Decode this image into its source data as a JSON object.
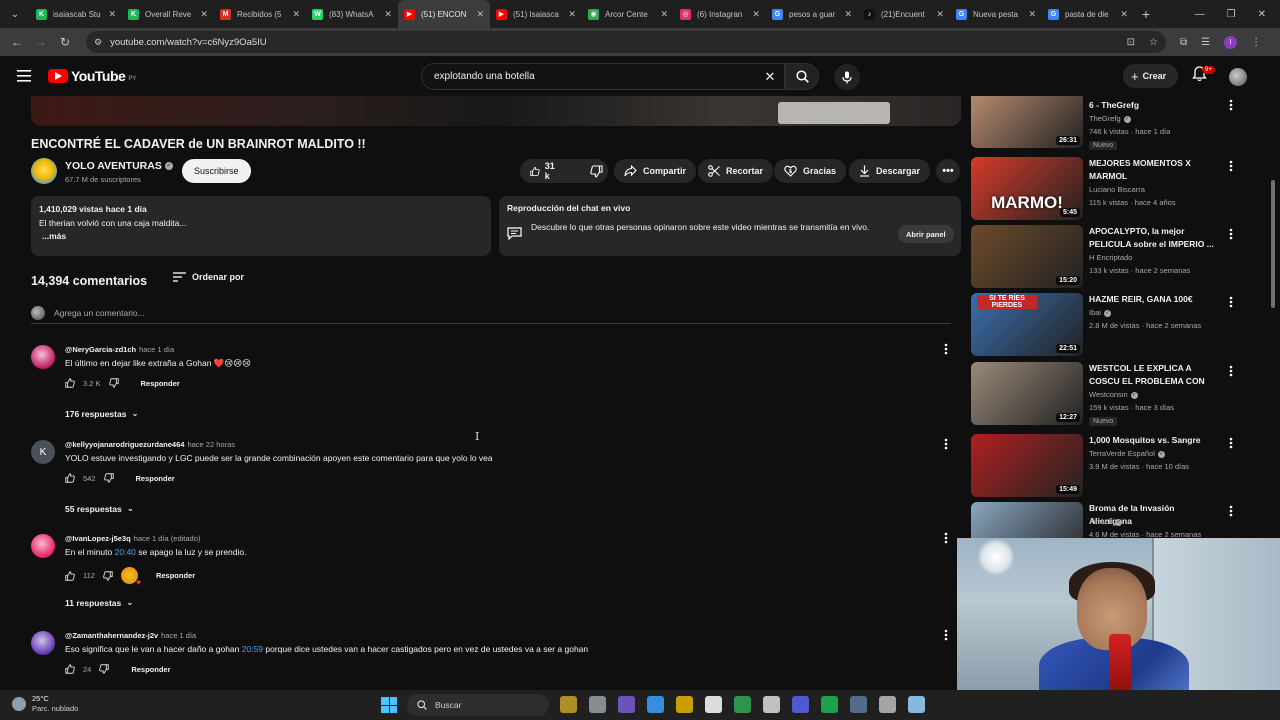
{
  "browser": {
    "tabs": [
      {
        "title": "isaiascab Stu",
        "color": "#1db954",
        "glyph": "K"
      },
      {
        "title": "Overall Reve",
        "color": "#1db954",
        "glyph": "K"
      },
      {
        "title": "Recibidos (5",
        "color": "#d93025",
        "glyph": "M"
      },
      {
        "title": "(83) WhatsA",
        "color": "#25d366",
        "glyph": "W"
      },
      {
        "title": "(51) ENCON",
        "color": "#ff0000",
        "glyph": "▶"
      },
      {
        "title": "(51) Isaiasca",
        "color": "#ff0000",
        "glyph": "▶"
      },
      {
        "title": "Arcor Cente",
        "color": "#34a853",
        "glyph": "◉"
      },
      {
        "title": "(6) Instagran",
        "color": "#e1306c",
        "glyph": "◎"
      },
      {
        "title": "pesos a guar",
        "color": "#4285f4",
        "glyph": "G"
      },
      {
        "title": "(21)Encuent",
        "color": "#111111",
        "glyph": "♪"
      },
      {
        "title": "Nueva pesta",
        "color": "#4285f4",
        "glyph": "G"
      },
      {
        "title": "pasta de die",
        "color": "#4285f4",
        "glyph": "G"
      }
    ],
    "active_tab_index": 4,
    "url": "youtube.com/watch?v=c6Nyz9Oa5IU"
  },
  "header": {
    "logo_text": "YouTube",
    "country_code": "PY",
    "search_query": "explotando una botella",
    "create_label": "Crear",
    "notifications_badge": "9+"
  },
  "video": {
    "title": "ENCONTRÉ EL CADAVER de UN BRAINROT MALDITO !!",
    "channel_name": "YOLO AVENTURAS",
    "subscribers": "67.7 M de suscriptores",
    "subscribe_label": "Suscribirse",
    "likes": "31 k",
    "share_label": "Compartir",
    "clip_label": "Recortar",
    "thanks_label": "Gracias",
    "download_label": "Descargar",
    "description": {
      "stats": "1,410,029 vistas  hace 1 día",
      "text": "El therian volvió con una caja maldita...",
      "more": "...más"
    },
    "chat_replay": {
      "title": "Reproducción del chat en vivo",
      "text": "Descubre lo que otras personas opinaron sobre este video mientras se transmitía en vivo.",
      "open_label": "Abrir panel"
    }
  },
  "comments": {
    "count_label": "14,394 comentarios",
    "sort_label": "Ordenar por",
    "add_placeholder": "Agrega un comentario...",
    "reply_label": "Responder",
    "items": [
      {
        "author": "@NeryGarcia-zd1ch",
        "when": "hace 1 día",
        "text": "El último en dejar like extraña a Gohan ❤️😢😢😢",
        "likes": "3.2 K",
        "replies": "176 respuestas",
        "avatar_color": "#c2185b",
        "avatar_letter": ""
      },
      {
        "author": "@kellyyojanarodriguezurdane464",
        "when": "hace 22 horas",
        "text": "YOLO estuve investigando y LGC puede ser la grande combinación apoyen este comentario para que yolo lo vea",
        "likes": "542",
        "replies": "55 respuestas",
        "avatar_color": "#5c6bc0",
        "avatar_letter": "K"
      },
      {
        "author": "@IvanLopez-j5e3q",
        "when": "hace 1 día (editado)",
        "text_before": "En el minuto ",
        "timestamp": "20:40",
        "text_after": " se apago la luz y se prendio.",
        "likes": "112",
        "replies": "11 respuestas",
        "avatar_color": "#e91e63",
        "avatar_letter": ""
      },
      {
        "author": "@Zamanthahernandez-j2v",
        "when": "hace 1 día",
        "text_before": "Eso significa que le van a hacer daño a gohan ",
        "timestamp": "20:59",
        "text_after": " porque dice ustedes van a hacer castigados pero en vez de ustedes va a ser a gohan",
        "likes": "24",
        "avatar_color": "#7e57c2",
        "avatar_letter": ""
      }
    ]
  },
  "recommendations": [
    {
      "title": "6 - TheGrefg",
      "channel": "TheGrefg",
      "verified": true,
      "views": "746 k vistas · hace 1 día",
      "badge": "Nuevo",
      "duration": "26:31",
      "thumb": "#b58a6e"
    },
    {
      "title": "MEJORES MOMENTOS X MARMOL",
      "channel": "Luciano Biscarra",
      "verified": false,
      "views": "115 k vistas · hace 4 años",
      "badge": "",
      "duration": "5:45",
      "thumb": "#d63a2a",
      "overlay": "MARMO!"
    },
    {
      "title": "APOCALYPTO, la mejor PELICULA sobre el IMPERIO ...",
      "channel": "H Encriptado",
      "verified": false,
      "views": "133 k vistas · hace 2 semanas",
      "badge": "",
      "duration": "15:20",
      "thumb": "#6b4a2a"
    },
    {
      "title": "HAZME REIR, GANA 100€",
      "channel": "Ibai",
      "verified": true,
      "views": "2.8 M de vistas · hace 2 semanas",
      "badge": "",
      "duration": "22:51",
      "thumb": "#3a6fb0",
      "overlay": "SI TE RÍES PIERDES"
    },
    {
      "title": "WESTCOL LE EXPLICA A COSCU EL PROBLEMA CON ...",
      "channel": "Westconsin",
      "verified": true,
      "views": "159 k vistas · hace 3 días",
      "badge": "Nuevo",
      "duration": "12:27",
      "thumb": "#9a8a7a"
    },
    {
      "title": "1,000 Mosquitos vs. Sangre",
      "channel": "TerraVerde Español",
      "verified": true,
      "views": "3.9 M de vistas · hace 10 días",
      "badge": "",
      "duration": "15:49",
      "thumb": "#b02020"
    },
    {
      "title": "Broma de la Invasión Alienígena",
      "channel": "Airrack",
      "verified": true,
      "views": "4.6 M de vistas · hace 2 semanas",
      "badge": "",
      "duration": "",
      "thumb": "#8aa6c0"
    }
  ],
  "taskbar": {
    "temperature": "25°C",
    "condition": "Parc. nublado",
    "search_label": "Buscar",
    "apps": [
      "#c9a227",
      "#9aa0a6",
      "#7b5cd6",
      "#3ba3ff",
      "#e8b400",
      "#ffffff",
      "#34a853",
      "#dddddd",
      "#5865f2",
      "#1db954",
      "#5c7aa0",
      "#bdbdbd",
      "#9ad3ff"
    ]
  }
}
